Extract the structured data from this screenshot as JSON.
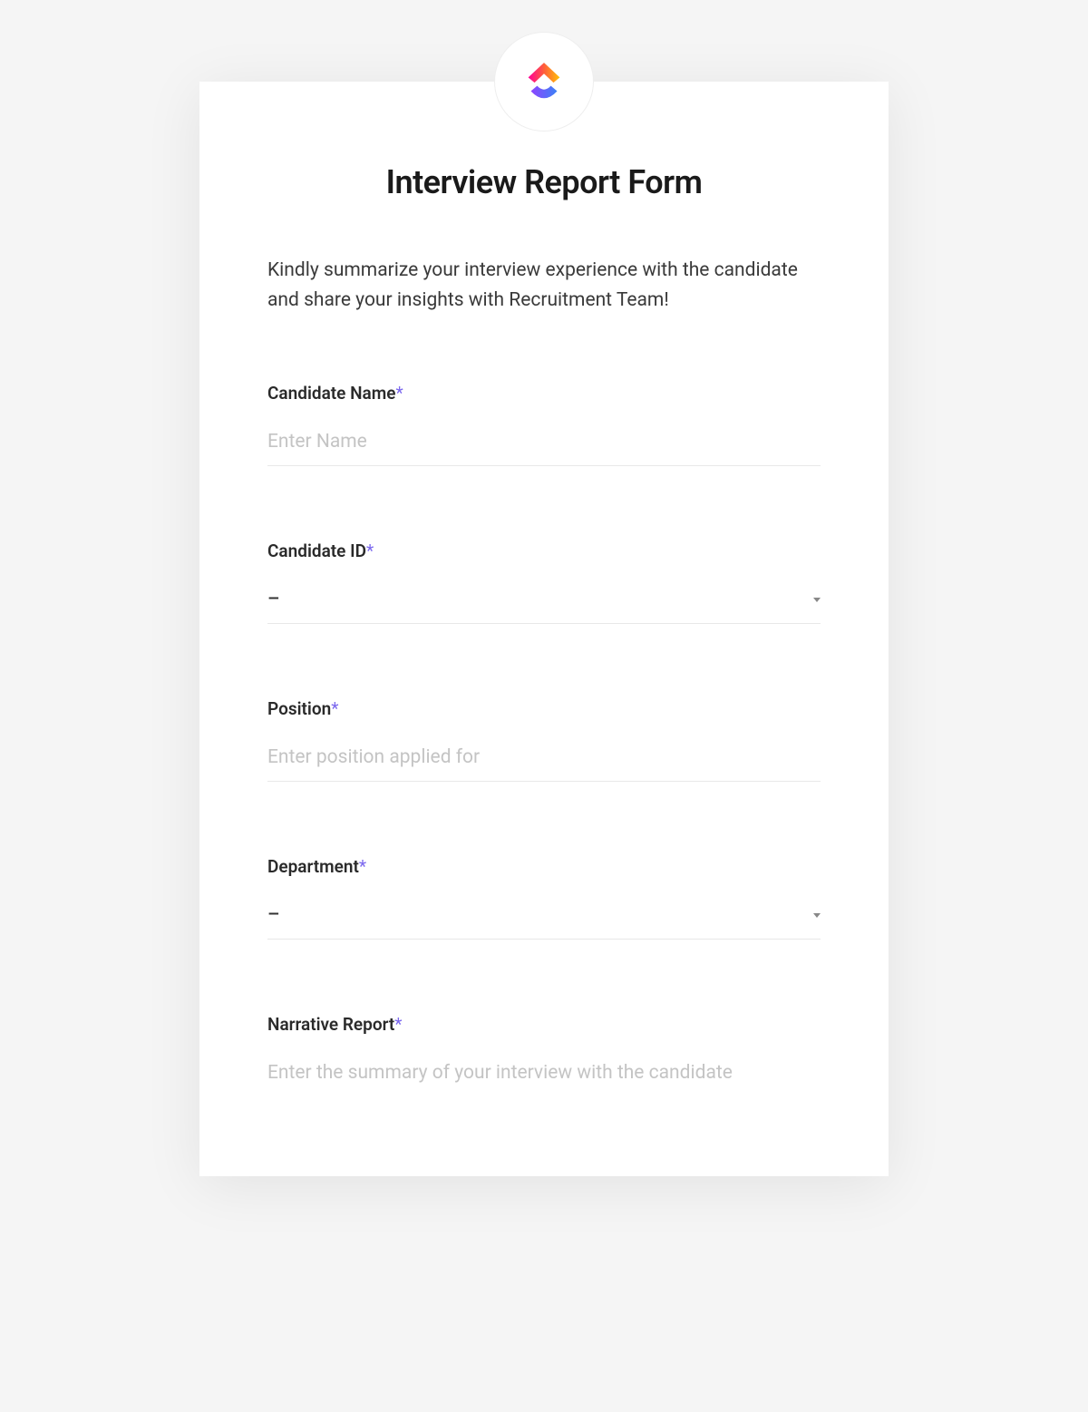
{
  "form": {
    "title": "Interview Report Form",
    "description": "Kindly summarize your interview experience with the candidate and share your insights with Recruitment Team!",
    "fields": {
      "candidate_name": {
        "label": "Candidate Name",
        "required": "*",
        "placeholder": "Enter Name"
      },
      "candidate_id": {
        "label": "Candidate ID",
        "required": "*",
        "value": "–"
      },
      "position": {
        "label": "Position",
        "required": "*",
        "placeholder": "Enter position applied for"
      },
      "department": {
        "label": "Department",
        "required": "*",
        "value": "–"
      },
      "narrative_report": {
        "label": "Narrative Report",
        "required": "*",
        "placeholder": "Enter the summary of your interview with the candidate"
      }
    }
  }
}
